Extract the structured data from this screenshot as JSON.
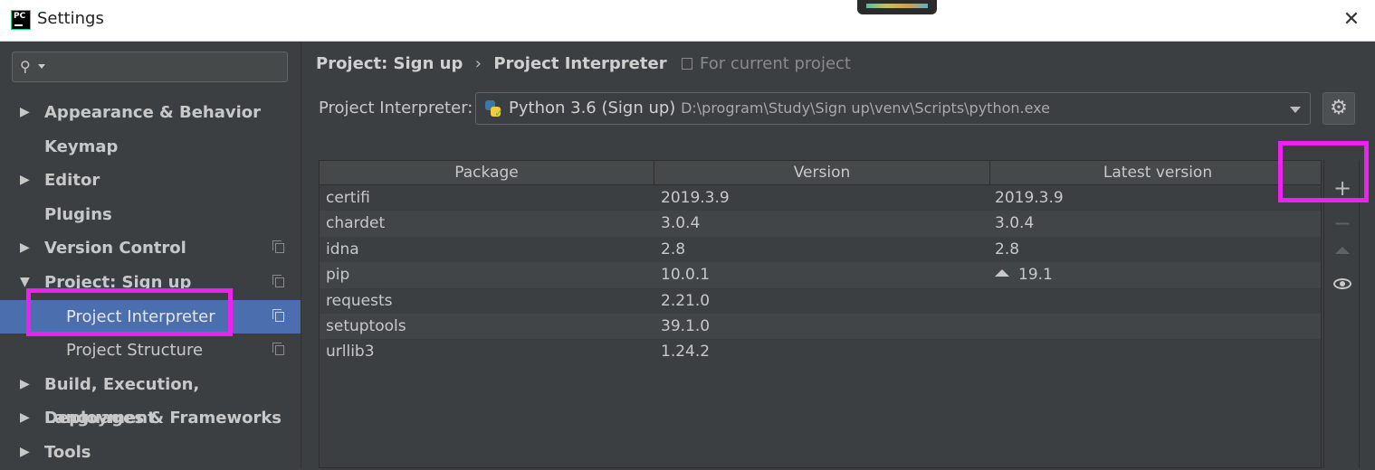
{
  "window": {
    "title": "Settings",
    "app_icon_text": "PC",
    "close_glyph": "✕"
  },
  "sidebar": {
    "search": {
      "value": "",
      "placeholder": ""
    },
    "items": [
      {
        "label": "Appearance & Behavior",
        "expandable": true,
        "expanded": false,
        "level": 0
      },
      {
        "label": "Keymap",
        "expandable": false,
        "level": 0
      },
      {
        "label": "Editor",
        "expandable": true,
        "expanded": false,
        "level": 0
      },
      {
        "label": "Plugins",
        "expandable": false,
        "level": 0
      },
      {
        "label": "Version Control",
        "expandable": true,
        "expanded": false,
        "level": 0,
        "project_scoped": true
      },
      {
        "label": "Project: Sign up",
        "expandable": true,
        "expanded": true,
        "level": 0,
        "project_scoped": true
      },
      {
        "label": "Project Interpreter",
        "expandable": false,
        "level": 1,
        "selected": true,
        "project_scoped": true
      },
      {
        "label": "Project Structure",
        "expandable": false,
        "level": 1,
        "project_scoped": true
      },
      {
        "label": "Build, Execution, Deployment",
        "expandable": true,
        "expanded": false,
        "level": 0
      },
      {
        "label": "Languages & Frameworks",
        "expandable": true,
        "expanded": false,
        "level": 0
      },
      {
        "label": "Tools",
        "expandable": true,
        "expanded": false,
        "level": 0
      }
    ],
    "arrow_collapsed": "▶",
    "arrow_expanded": "▼"
  },
  "main": {
    "breadcrumb": {
      "parent": "Project: Sign up",
      "separator": "›",
      "current": "Project Interpreter"
    },
    "scope_label": "For current project",
    "interpreter": {
      "label": "Project Interpreter:",
      "name": "Python 3.6 (Sign up)",
      "path": "D:\\program\\Study\\Sign up\\venv\\Scripts\\python.exe"
    },
    "gear_glyph": "⚙",
    "table": {
      "columns": [
        "Package",
        "Version",
        "Latest version"
      ],
      "rows": [
        {
          "package": "certifi",
          "version": "2019.3.9",
          "latest": "2019.3.9",
          "upgrade": false
        },
        {
          "package": "chardet",
          "version": "3.0.4",
          "latest": "3.0.4",
          "upgrade": false
        },
        {
          "package": "idna",
          "version": "2.8",
          "latest": "2.8",
          "upgrade": false
        },
        {
          "package": "pip",
          "version": "10.0.1",
          "latest": "19.1",
          "upgrade": true
        },
        {
          "package": "requests",
          "version": "2.21.0",
          "latest": "",
          "upgrade": false
        },
        {
          "package": "setuptools",
          "version": "39.1.0",
          "latest": "",
          "upgrade": false
        },
        {
          "package": "urllib3",
          "version": "1.24.2",
          "latest": "",
          "upgrade": false
        }
      ]
    },
    "toolbar": {
      "add_glyph": "+",
      "remove_glyph": "−"
    }
  },
  "colors": {
    "background": "#3c3f41",
    "selection": "#4b6eaf",
    "highlight": "#ee22ee"
  }
}
